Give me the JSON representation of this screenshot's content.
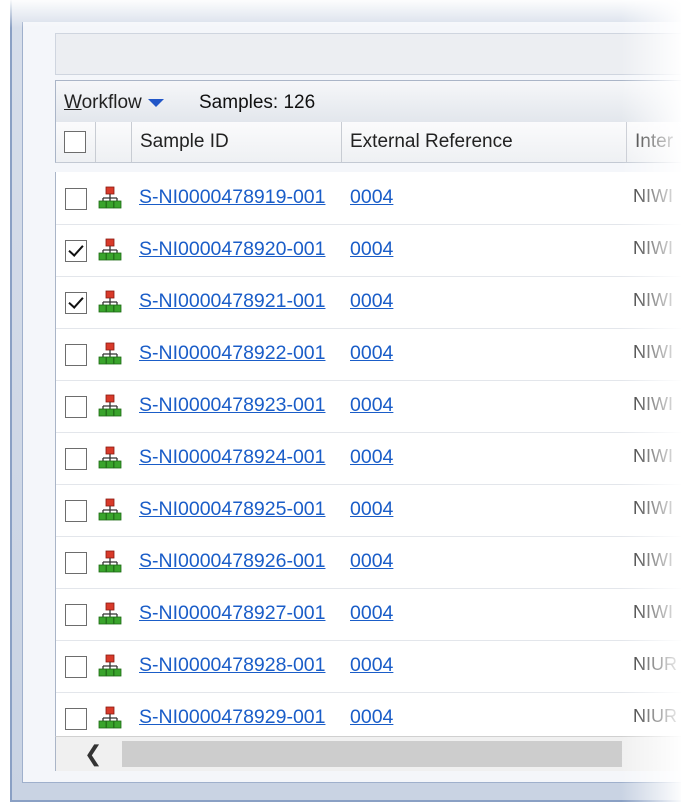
{
  "toolbar": {
    "workflow_prefix": "W",
    "workflow_rest": "orkflow",
    "samples_label": "Samples: 126"
  },
  "columns": {
    "sample_id": "Sample ID",
    "external_reference": "External Reference",
    "internal": "Inter"
  },
  "icons": {
    "workflow": "workflow-hierarchy-icon",
    "scroll_left": "chevron-left-icon"
  },
  "colors": {
    "link": "#1a5dc8",
    "icon_top": "#d83a2a",
    "icon_bottom": "#39a42c"
  },
  "rows": [
    {
      "sample_id": "S-NI0000478919-001",
      "ext_ref": "0004",
      "internal": "NIWI",
      "checked": false
    },
    {
      "sample_id": "S-NI0000478920-001",
      "ext_ref": "0004",
      "internal": "NIWI",
      "checked": true
    },
    {
      "sample_id": "S-NI0000478921-001",
      "ext_ref": "0004",
      "internal": "NIWI",
      "checked": true
    },
    {
      "sample_id": "S-NI0000478922-001",
      "ext_ref": "0004",
      "internal": "NIWI",
      "checked": false
    },
    {
      "sample_id": "S-NI0000478923-001",
      "ext_ref": "0004",
      "internal": "NIWI",
      "checked": false
    },
    {
      "sample_id": "S-NI0000478924-001",
      "ext_ref": "0004",
      "internal": "NIWI",
      "checked": false
    },
    {
      "sample_id": "S-NI0000478925-001",
      "ext_ref": "0004",
      "internal": "NIWI",
      "checked": false
    },
    {
      "sample_id": "S-NI0000478926-001",
      "ext_ref": "0004",
      "internal": "NIWI",
      "checked": false
    },
    {
      "sample_id": "S-NI0000478927-001",
      "ext_ref": "0004",
      "internal": "NIWI",
      "checked": false
    },
    {
      "sample_id": "S-NI0000478928-001",
      "ext_ref": "0004",
      "internal": "NIUR",
      "checked": false
    },
    {
      "sample_id": "S-NI0000478929-001",
      "ext_ref": "0004",
      "internal": "NIUR",
      "checked": false
    }
  ]
}
